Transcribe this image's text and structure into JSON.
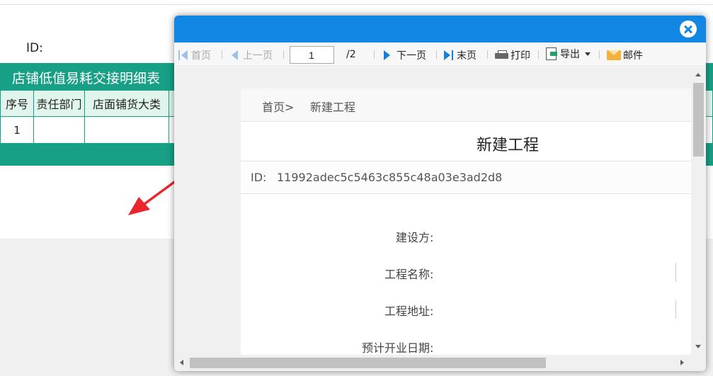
{
  "background": {
    "id_label": "ID:",
    "report_title": "店铺低值易耗交接明细表",
    "columns": [
      "序号",
      "责任部门",
      "店面铺货大类",
      ""
    ],
    "rows": [
      [
        "1",
        "",
        "",
        ""
      ]
    ],
    "header_color": "#17a085",
    "header_cell_bg": "#e0f5ec"
  },
  "annotation": {
    "arrow_color": "#e8262b"
  },
  "modal": {
    "header_color": "#1186e3",
    "close_icon": "close-circle-icon",
    "toolbar": {
      "first_label": "首页",
      "prev_label": "上一页",
      "page_value": "1",
      "page_total": "/2",
      "next_label": "下一页",
      "last_label": "末页",
      "print_label": "打印",
      "export_label": "导出",
      "mail_label": "邮件",
      "icons": [
        "first-page-icon",
        "prev-page-icon",
        "next-page-icon",
        "last-page-icon",
        "printer-icon",
        "export-icon",
        "mail-icon"
      ]
    },
    "document": {
      "breadcrumb_home": "首页>",
      "breadcrumb_current": "新建工程",
      "title": "新建工程",
      "id_label": "ID:",
      "id_value": "11992adec5c5463c855c48a03e3ad2d8",
      "fields": [
        {
          "label": "建设方:"
        },
        {
          "label": "工程名称:"
        },
        {
          "label": "工程地址:"
        },
        {
          "label": "预计开业日期:"
        }
      ]
    }
  }
}
